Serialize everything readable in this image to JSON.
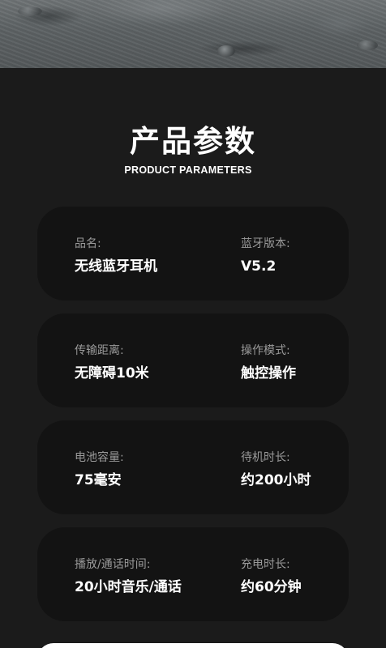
{
  "header": {
    "title": "产品参数",
    "subtitle": "PRODUCT PARAMETERS"
  },
  "params": [
    {
      "left": {
        "label": "品名:",
        "value": "无线蓝牙耳机"
      },
      "right": {
        "label": "蓝牙版本:",
        "value": "V5.2"
      }
    },
    {
      "left": {
        "label": "传输距离:",
        "value": "无障碍10米"
      },
      "right": {
        "label": "操作模式:",
        "value": "触控操作"
      }
    },
    {
      "left": {
        "label": "电池容量:",
        "value": "75毫安"
      },
      "right": {
        "label": "待机时长:",
        "value": "约200小时"
      }
    },
    {
      "left": {
        "label": "播放/通话时间:",
        "value": "20小时音乐/通话"
      },
      "right": {
        "label": "充电时长:",
        "value": "约60分钟"
      }
    }
  ]
}
